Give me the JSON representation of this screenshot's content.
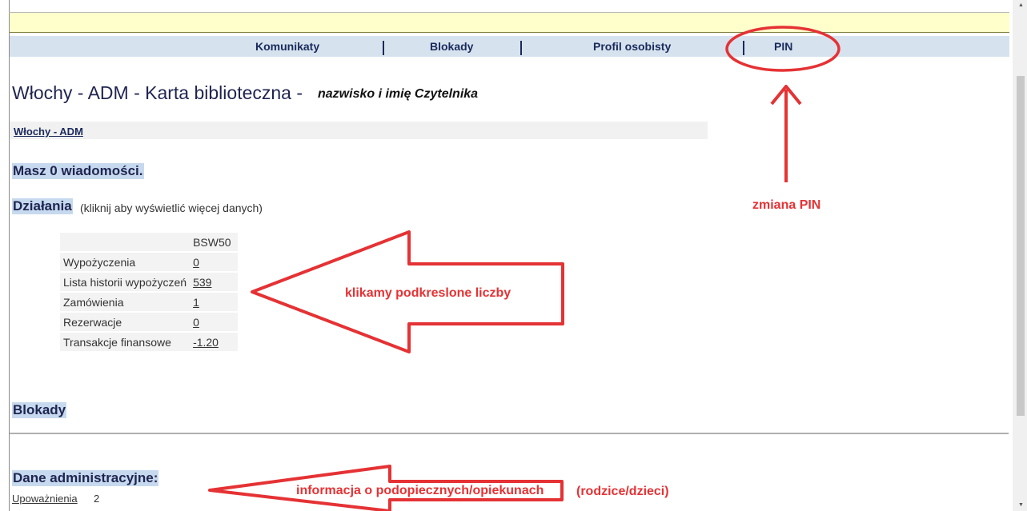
{
  "nav": {
    "items": [
      "Komunikaty",
      "Blokady",
      "Profil osobisty",
      "PIN"
    ],
    "separator": "|"
  },
  "header": {
    "title": "Włochy - ADM - Karta biblioteczna -",
    "title_note": "nazwisko i imię Czytelnika"
  },
  "breadcrumb": {
    "label": "Włochy - ADM"
  },
  "messages": {
    "heading": "Masz 0 wiadomości."
  },
  "actions": {
    "heading": "Działania",
    "hint": "(kliknij aby wyświetlić więcej danych)",
    "column_header": "BSW50",
    "rows": [
      {
        "label": "Wypożyczenia",
        "value": "0"
      },
      {
        "label": "Lista historii wypożyczeń",
        "value": "539"
      },
      {
        "label": "Zamówienia",
        "value": "1"
      },
      {
        "label": "Rezerwacje",
        "value": "0"
      },
      {
        "label": "Transakcje finansowe",
        "value": "-1.20"
      }
    ]
  },
  "blocks": {
    "heading": "Blokady"
  },
  "admin": {
    "heading": "Dane administracyjne:",
    "link_label": "Upoważnienia",
    "count": "2"
  },
  "annotations": {
    "pin_note": "zmiana PIN",
    "numbers_note": "klikamy podkreslone liczby",
    "wards_note": "informacja o podopiecznych/opiekunach",
    "wards_extra": "(rodzice/dzieci)",
    "color": "#e53234"
  },
  "colors": {
    "nav_background": "#d6e3ee",
    "top_bar": "#ffffcc",
    "heading_highlight": "#c6d9ee",
    "heading_text": "#1f2450"
  }
}
